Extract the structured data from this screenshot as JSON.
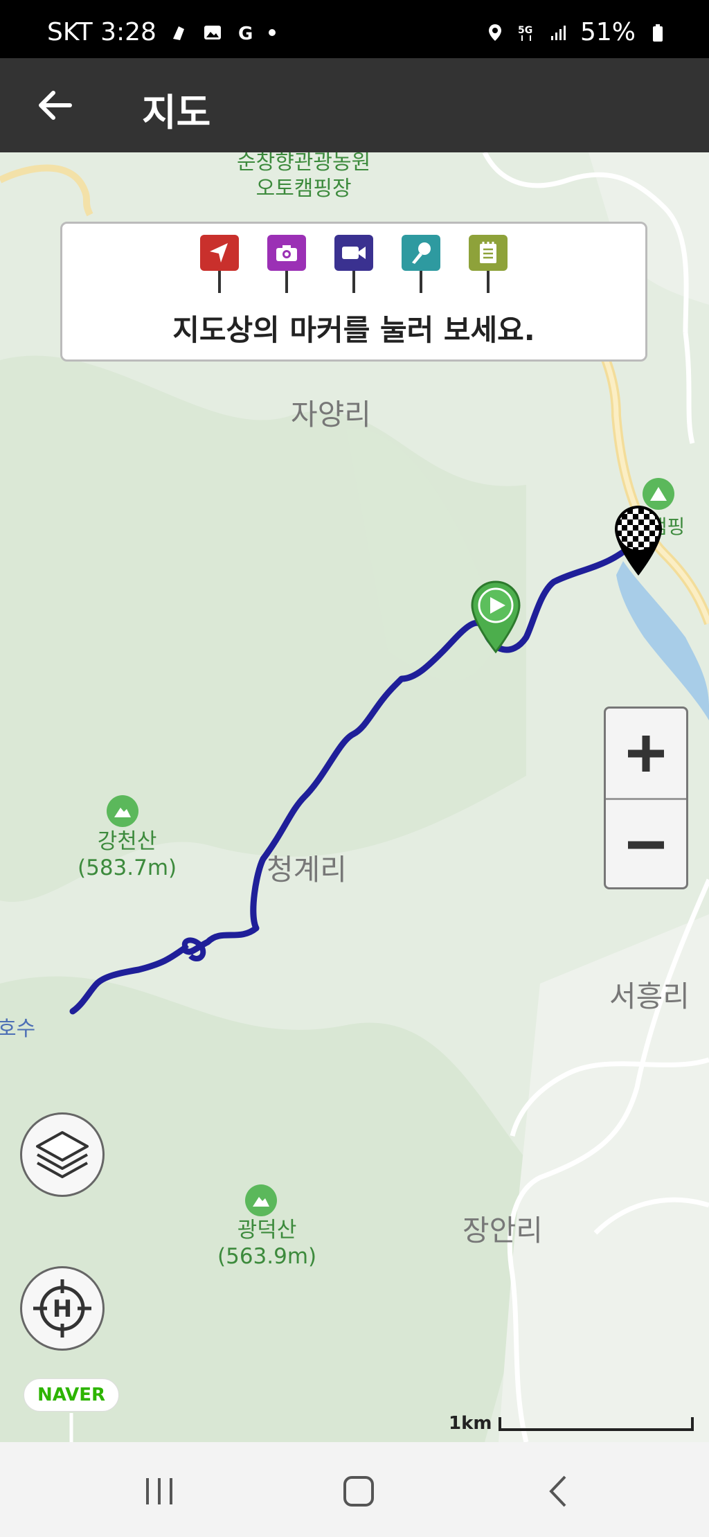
{
  "status": {
    "carrier_time": "SKT 3:28",
    "battery": "51%"
  },
  "appbar": {
    "title": "지도"
  },
  "legend": {
    "markers": [
      {
        "name": "location",
        "color": "#c9302c"
      },
      {
        "name": "camera",
        "color": "#9b30b5"
      },
      {
        "name": "video",
        "color": "#3a3190"
      },
      {
        "name": "voice",
        "color": "#2e9aa0"
      },
      {
        "name": "memo",
        "color": "#8ea23a"
      }
    ],
    "text": "지도상의 마커를 눌러 보세요."
  },
  "map": {
    "places": {
      "camping_top": "순창향관광농원\n오토캠핑장",
      "jayang": "자양리",
      "cheonggye": "청계리",
      "seoheung": "서흥리",
      "jangan": "장안리",
      "lake": "호수",
      "camping_right": "산캠핑"
    },
    "mountains": {
      "gangcheon": "강천산\n(583.7m)",
      "gwangdeok": "광덕산\n(563.9m)"
    }
  },
  "naver_logo": "NAVER",
  "scale_label": "1km"
}
